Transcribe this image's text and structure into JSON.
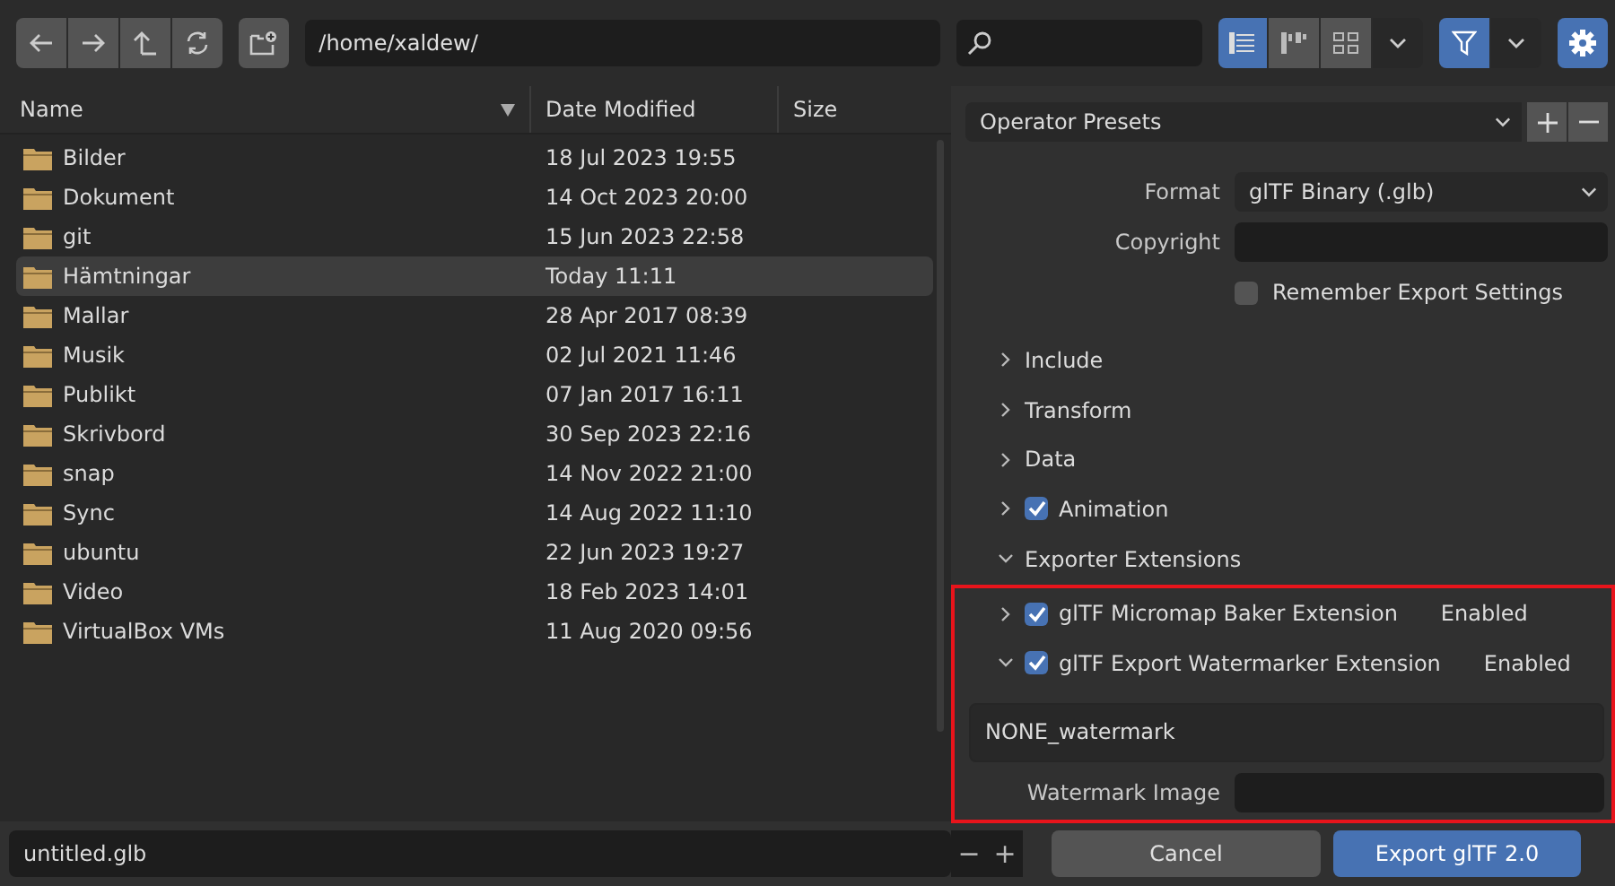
{
  "toolbar": {
    "path": "/home/xaldew/",
    "view_modes": [
      {
        "selected": true
      },
      {
        "selected": false
      },
      {
        "selected": false
      }
    ],
    "filter": {
      "on": true
    },
    "settings": {
      "on": true
    }
  },
  "file_list": {
    "columns": [
      {
        "label": "Name",
        "sorted": true
      },
      {
        "label": "Date Modified",
        "sorted": false
      },
      {
        "label": "Size",
        "sorted": false
      }
    ],
    "rows": [
      {
        "name": "Bilder",
        "date": "18 Jul 2023 19:55",
        "selected": false
      },
      {
        "name": "Dokument",
        "date": "14 Oct 2023 20:00",
        "selected": false
      },
      {
        "name": "git",
        "date": "15 Jun 2023 22:58",
        "selected": false
      },
      {
        "name": "Hämtningar",
        "date": "Today 11:11",
        "selected": true
      },
      {
        "name": "Mallar",
        "date": "28 Apr 2017 08:39",
        "selected": false
      },
      {
        "name": "Musik",
        "date": "02 Jul 2021 11:46",
        "selected": false
      },
      {
        "name": "Publikt",
        "date": "07 Jan 2017 16:11",
        "selected": false
      },
      {
        "name": "Skrivbord",
        "date": "30 Sep 2023 22:16",
        "selected": false
      },
      {
        "name": "snap",
        "date": "14 Nov 2022 21:00",
        "selected": false
      },
      {
        "name": "Sync",
        "date": "14 Aug 2022 11:10",
        "selected": false
      },
      {
        "name": "ubuntu",
        "date": "22 Jun 2023 19:27",
        "selected": false
      },
      {
        "name": "Video",
        "date": "18 Feb 2023 14:01",
        "selected": false
      },
      {
        "name": "VirtualBox VMs",
        "date": "11 Aug 2020 09:56",
        "selected": false
      }
    ]
  },
  "settings_panel": {
    "presets": "Operator Presets",
    "format": {
      "label": "Format",
      "value": "glTF Binary (.glb)"
    },
    "copyright": {
      "label": "Copyright"
    },
    "remember": {
      "label": "Remember Export Settings",
      "checked": false
    },
    "sections": [
      {
        "label": "Include",
        "kind": "section",
        "expanded": false
      },
      {
        "label": "Transform",
        "kind": "section",
        "expanded": false
      },
      {
        "label": "Data",
        "kind": "section",
        "expanded": false
      },
      {
        "label": "Animation",
        "kind": "check",
        "expanded": false,
        "checked": true
      },
      {
        "label": "Exporter Extensions",
        "kind": "section",
        "expanded": true
      }
    ],
    "extensions": {
      "highlighted": true,
      "items": [
        {
          "label": "glTF Micromap Baker Extension",
          "status": "Enabled",
          "checked": true,
          "expanded": false
        },
        {
          "label": "glTF Export Watermarker Extension",
          "status": "Enabled",
          "checked": true,
          "expanded": true
        }
      ],
      "watermark_text": "NONE_watermark",
      "watermark_image": {
        "label": "Watermark Image"
      }
    }
  },
  "footer": {
    "filename": "untitled.glb",
    "decrement": "−",
    "increment": "+",
    "cancel": "Cancel",
    "export": "Export glTF 2.0"
  }
}
